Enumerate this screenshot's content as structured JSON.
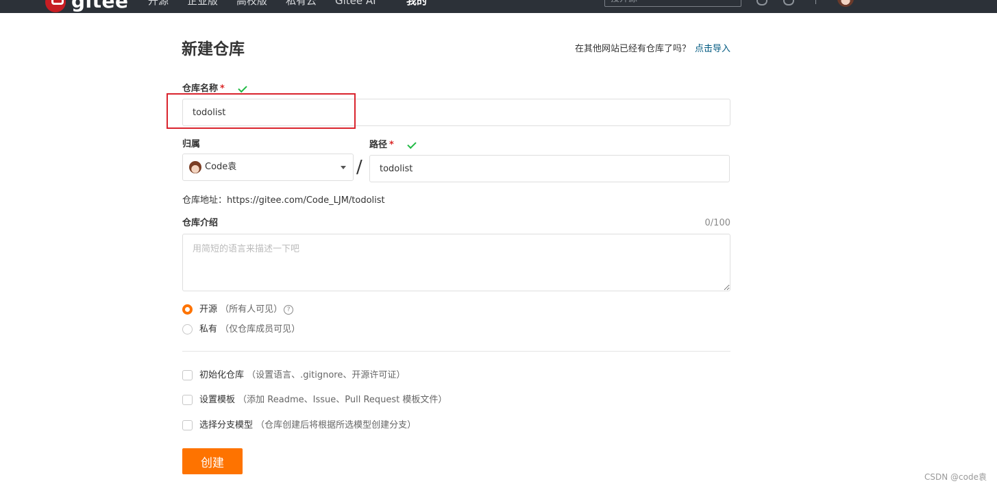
{
  "topbar": {
    "logo_text": "gitee",
    "nav": [
      "开源",
      "企业版",
      "高校版",
      "私有云",
      "Gitee AI",
      "我的"
    ],
    "search_placeholder": "搜开源"
  },
  "header": {
    "title": "新建仓库",
    "import_hint": "在其他网站已经有仓库了吗？",
    "import_link": "点击导入"
  },
  "form": {
    "repo_name_label": "仓库名称",
    "required_mark": "*",
    "repo_name_value": "todolist",
    "owner_label": "归属",
    "owner_value": "Code袁",
    "path_label": "路径",
    "path_value": "todolist",
    "separator": "/",
    "repo_url": "仓库地址：https://gitee.com/Code_LJM/todolist",
    "intro_label": "仓库介绍",
    "intro_counter": "0/100",
    "intro_placeholder": "用简短的语言来描述一下吧",
    "visibility": {
      "public_label": "开源",
      "public_note": "（所有人可见）",
      "private_label": "私有",
      "private_note": "（仅仓库成员可见）",
      "selected": "public"
    },
    "options": [
      {
        "label": "初始化仓库",
        "note": "（设置语言、.gitignore、开源许可证）",
        "checked": false
      },
      {
        "label": "设置模板",
        "note": "（添加 Readme、Issue、Pull Request 模板文件）",
        "checked": false
      },
      {
        "label": "选择分支模型",
        "note": "（仓库创建后将根据所选模型创建分支）",
        "checked": false
      }
    ],
    "submit_label": "创建"
  },
  "colors": {
    "accent": "#fe7300",
    "topbar_bg": "#2c3138",
    "link": "#005980",
    "success": "#21ba45",
    "required": "#db2828",
    "highlight": "#d9232d"
  },
  "watermark": "CSDN @code袁"
}
